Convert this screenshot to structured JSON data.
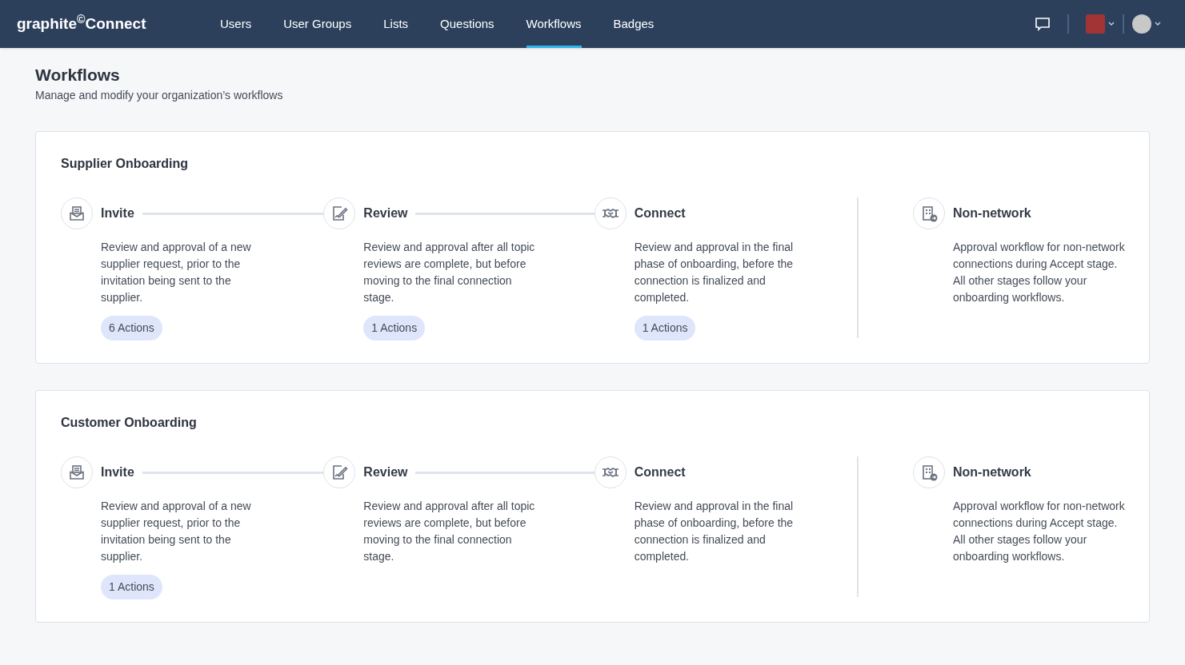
{
  "header": {
    "logo": "graphite$^{©}$Connect",
    "nav": [
      {
        "label": "Users",
        "selected": false
      },
      {
        "label": "User Groups",
        "selected": false
      },
      {
        "label": "Lists",
        "selected": false
      },
      {
        "label": "Questions",
        "selected": false
      },
      {
        "label": "Workflows",
        "selected": true
      },
      {
        "label": "Badges",
        "selected": false
      }
    ]
  },
  "page": {
    "title": "Workflows",
    "subtitle": "Manage and modify your organization’s workflows"
  },
  "workflows": [
    {
      "title": "Supplier Onboarding",
      "steps": [
        {
          "kind": "stage",
          "label": "Invite",
          "description": "Review and approval of a new supplier request, prior to the invitation being sent to the supplier.",
          "actions": "6 Actions"
        },
        {
          "kind": "stage",
          "label": "Review",
          "description": "Review and approval after all topic reviews are complete, but before moving to the final connection stage.",
          "actions": "1 Actions"
        },
        {
          "kind": "stage",
          "label": "Connect",
          "description": "Review and approval in the final phase of onboarding, before the connection is finalized and completed.",
          "actions": "1 Actions"
        },
        {
          "kind": "non_network",
          "label": "Non-network",
          "description": "Approval workflow for non-network connections during Accept stage. All other stages follow your onboarding workflows."
        }
      ]
    },
    {
      "title": "Customer Onboarding",
      "steps": [
        {
          "kind": "stage",
          "label": "Invite",
          "description": "Review and approval of a new supplier request, prior to the invitation being sent to the supplier.",
          "actions": "1 Actions"
        },
        {
          "kind": "stage",
          "label": "Review",
          "description": "Review and approval after all topic reviews are complete, but before moving to the final connection stage."
        },
        {
          "kind": "stage",
          "label": "Connect",
          "description": "Review and approval in the final phase of onboarding, before the connection is finalized and completed."
        },
        {
          "kind": "non_network",
          "label": "Non-network",
          "description": "Approval workflow for non-network connections during Accept stage. All other stages follow your onboarding workflows."
        }
      ]
    }
  ]
}
